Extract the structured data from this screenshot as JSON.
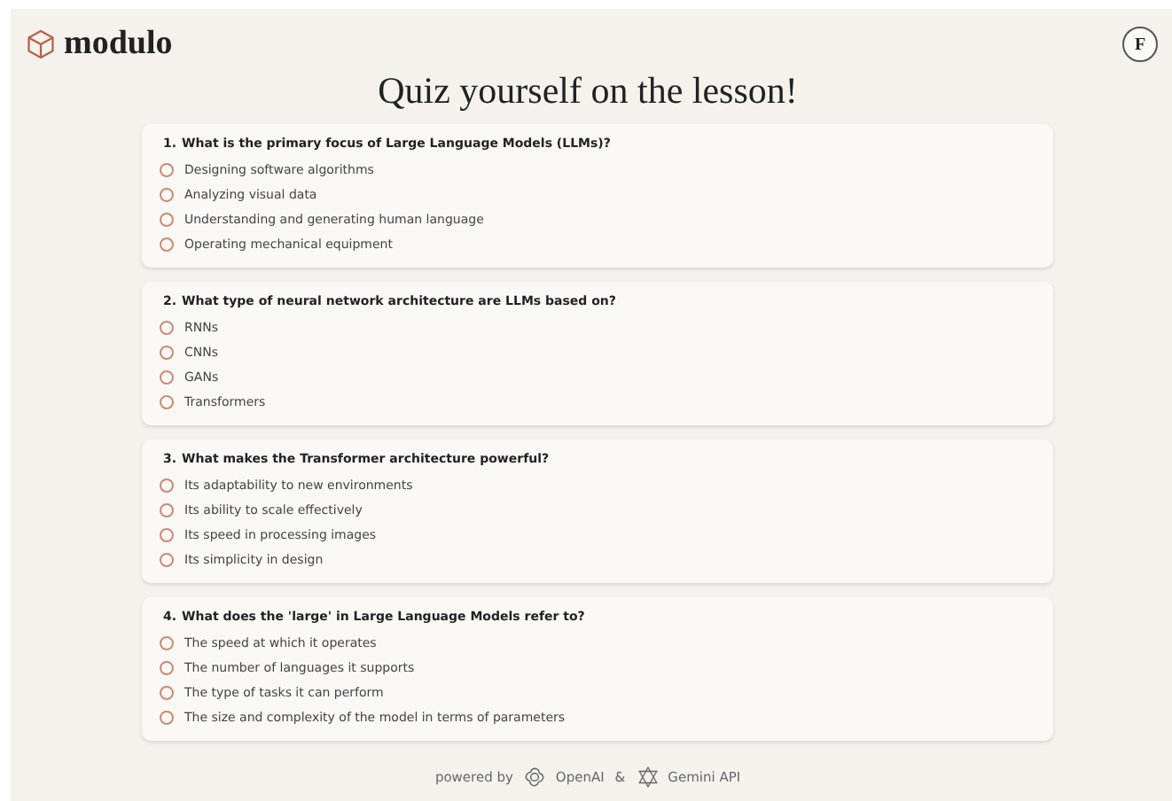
{
  "header": {
    "logo": "modulo",
    "avatar": "F"
  },
  "title": "Quiz yourself on the lesson!",
  "questions": [
    {
      "number": "1.",
      "text": "What is the primary focus of Large Language Models (LLMs)?",
      "options": [
        {
          "label": "Designing software algorithms",
          "selected": false
        },
        {
          "label": "Analyzing visual data",
          "selected": false
        },
        {
          "label": "Understanding and generating human language",
          "selected": false
        },
        {
          "label": "Operating mechanical equipment",
          "selected": false
        }
      ]
    },
    {
      "number": "2.",
      "text": "What type of neural network architecture are LLMs based on?",
      "options": [
        {
          "label": "RNNs",
          "selected": false
        },
        {
          "label": "CNNs",
          "selected": false
        },
        {
          "label": "GANs",
          "selected": false
        },
        {
          "label": "Transformers",
          "selected": false
        }
      ]
    },
    {
      "number": "3.",
      "text": "What makes the Transformer architecture powerful?",
      "options": [
        {
          "label": "Its adaptability to new environments",
          "selected": false
        },
        {
          "label": "Its ability to scale effectively",
          "selected": false
        },
        {
          "label": "Its speed in processing images",
          "selected": false
        },
        {
          "label": "Its simplicity in design",
          "selected": false
        }
      ]
    },
    {
      "number": "4.",
      "text": "What does the 'large' in Large Language Models refer to?",
      "options": [
        {
          "label": "The speed at which it operates",
          "selected": false
        },
        {
          "label": "The number of languages it supports",
          "selected": false
        },
        {
          "label": "The type of tasks it can perform",
          "selected": false
        },
        {
          "label": "The size and complexity of the model in terms of parameters",
          "selected": false
        }
      ]
    }
  ],
  "footer": {
    "powered_by": "powered by",
    "provider_1": "OpenAI",
    "separator": "&",
    "provider_2": "Gemini API"
  }
}
